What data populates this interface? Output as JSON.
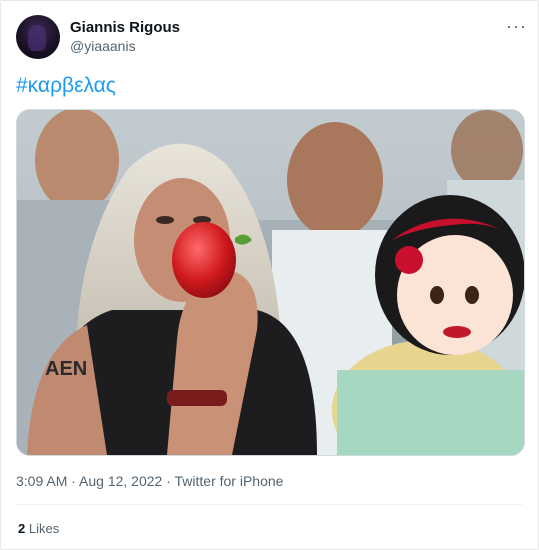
{
  "tweet": {
    "author_name": "Giannis Rigous",
    "author_handle": "@yiaaanis",
    "text": "#καρβελας",
    "timestamp": "3:09 AM · Aug 12, 2022 · Twitter for iPhone",
    "likes_count": "2",
    "likes_label": "Likes",
    "more_icon": "···"
  },
  "colors": {
    "link": "#1d9bf0",
    "secondary_text": "#536471",
    "primary_text": "#0f1419",
    "border": "#cfd9de"
  },
  "icons": [
    "more-options-icon"
  ],
  "media": {
    "type": "photo",
    "tattoo_text": "AEN"
  }
}
